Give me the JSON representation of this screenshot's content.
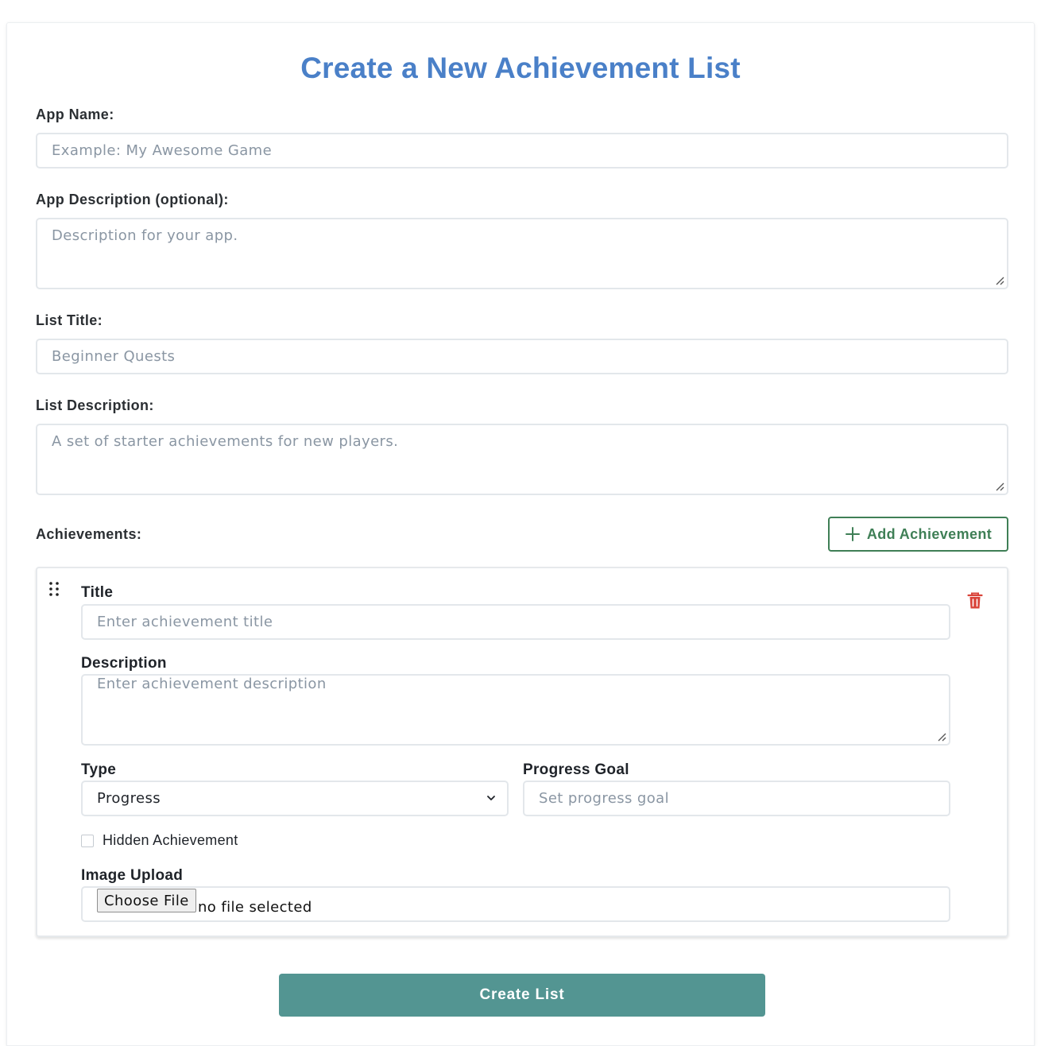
{
  "page": {
    "title": "Create a New Achievement List"
  },
  "form": {
    "app_name": {
      "label": "App Name:",
      "placeholder": "Example: My Awesome Game",
      "value": ""
    },
    "app_description": {
      "label": "App Description (optional):",
      "placeholder": "Description for your app.",
      "value": ""
    },
    "list_title": {
      "label": "List Title:",
      "placeholder": "Beginner Quests",
      "value": ""
    },
    "list_description": {
      "label": "List Description:",
      "placeholder": "A set of starter achievements for new players.",
      "value": ""
    }
  },
  "achievements": {
    "label": "Achievements:",
    "add_button": {
      "label": "Add Achievement",
      "icon": "plus-icon"
    },
    "items": [
      {
        "drag_icon": "drag-handle-icon",
        "delete_icon": "trash-icon",
        "title": {
          "label": "Title",
          "placeholder": "Enter achievement title"
        },
        "description": {
          "label": "Description",
          "placeholder": "Enter achievement description"
        },
        "type": {
          "label": "Type",
          "selected": "Progress"
        },
        "progress_goal": {
          "label": "Progress Goal",
          "placeholder": "Set progress goal"
        },
        "hidden": {
          "label": "Hidden Achievement",
          "checked": false
        },
        "image_upload": {
          "label": "Image Upload",
          "button": "Choose File",
          "status": "no file selected"
        }
      }
    ]
  },
  "submit": {
    "label": "Create List"
  },
  "colors": {
    "title": "#4a80c8",
    "add_button": "#3f7f56",
    "submit_button": "#539592",
    "delete_icon": "#d9443a"
  }
}
